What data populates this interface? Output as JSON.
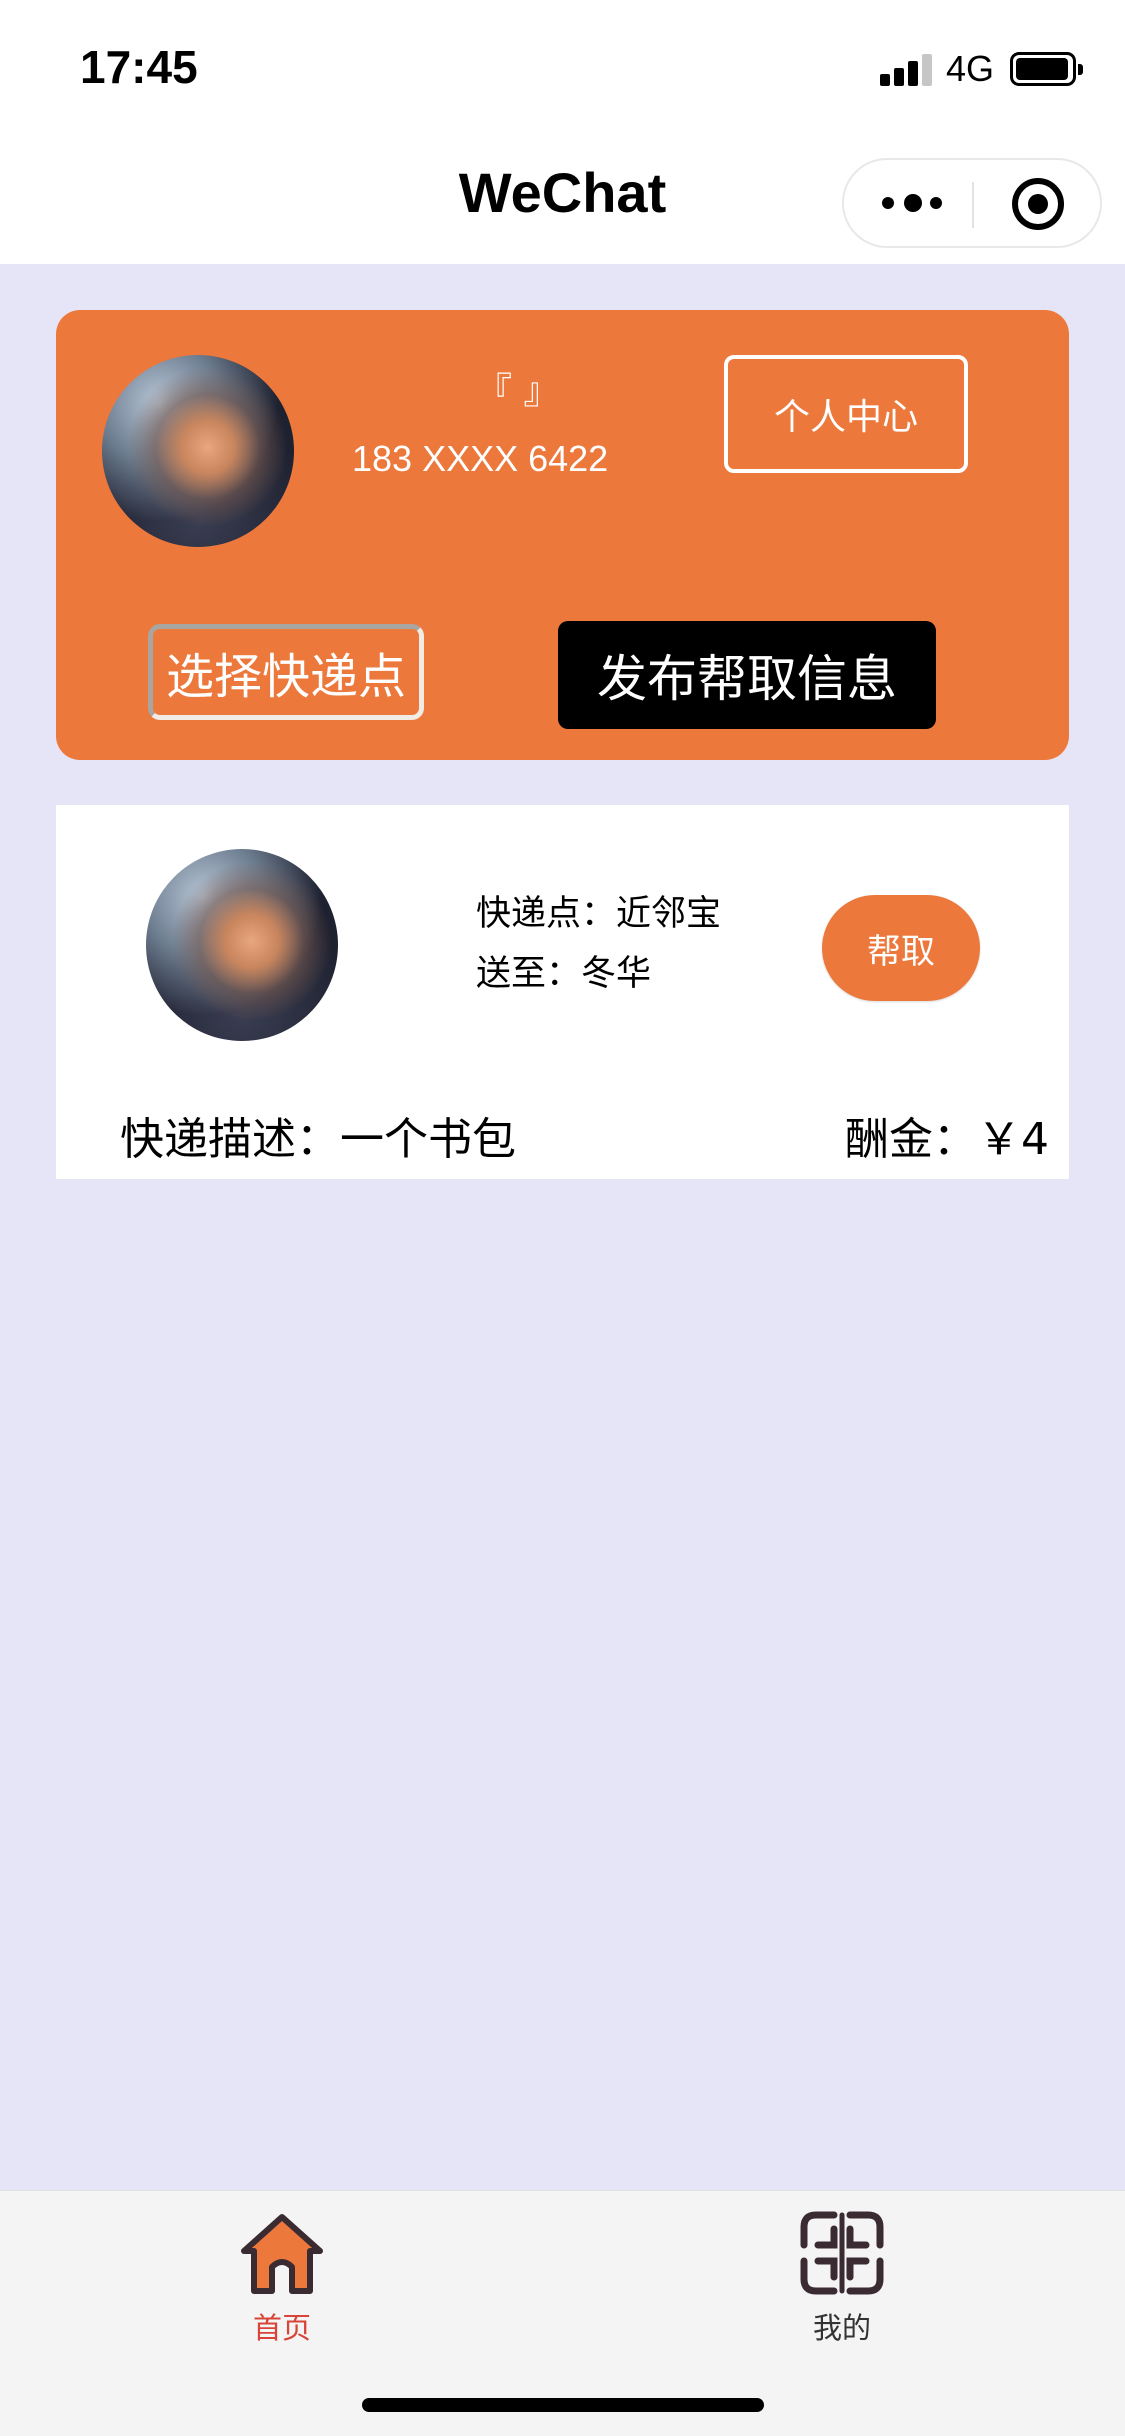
{
  "status_bar": {
    "time": "17:45",
    "network": "4G"
  },
  "nav": {
    "title": "WeChat"
  },
  "profile": {
    "name": "『 』",
    "phone": "183 XXXX 6422",
    "personal_center_label": "个人中心",
    "select_station_label": "选择快递点",
    "publish_label": "发布帮取信息"
  },
  "items": [
    {
      "pickup_text": "快递点：近邻宝",
      "destination_text": "送至：冬华",
      "help_label": "帮取",
      "description_text": "快递描述：一个书包",
      "reward_text": "酬金：￥4"
    }
  ],
  "tabbar": {
    "home_label": "首页",
    "mine_label": "我的"
  },
  "colors": {
    "accent": "#ec783c",
    "page_background": "#e6e4f7",
    "active_tab": "#d9443a"
  },
  "icons": {
    "home_tab": "home-icon",
    "mine_tab": "grid-knot-icon",
    "more": "more-dots-icon",
    "close": "target-icon"
  }
}
